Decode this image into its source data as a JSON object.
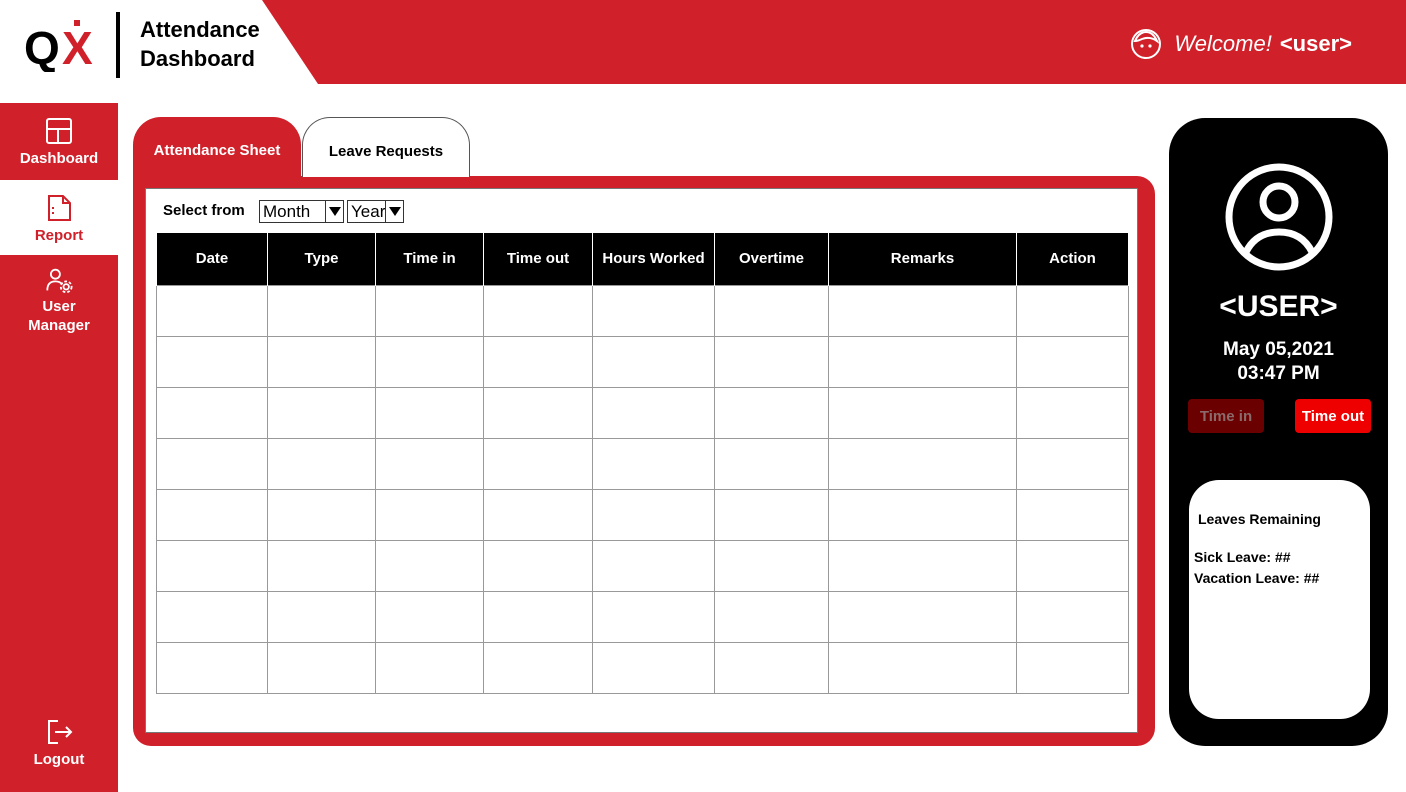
{
  "header": {
    "logo_text": "QX",
    "title_line1": "Attendance",
    "title_line2": "Dashboard",
    "welcome_text": "Welcome!",
    "username": "<user>"
  },
  "sidebar": {
    "items": [
      {
        "label": "Dashboard",
        "icon": "dashboard-icon",
        "active": false
      },
      {
        "label": "Report",
        "icon": "report-icon",
        "active": true
      },
      {
        "label_line1": "User",
        "label_line2": "Manager",
        "icon": "user-manager-icon",
        "active": false
      },
      {
        "label": "Logout",
        "icon": "logout-icon",
        "active": false
      }
    ]
  },
  "tabs": [
    {
      "label": "Attendance Sheet",
      "active": true
    },
    {
      "label": "Leave Requests",
      "active": false
    }
  ],
  "filters": {
    "label": "Select from",
    "month": "Month",
    "year": "Year"
  },
  "table": {
    "columns": [
      "Date",
      "Type",
      "Time in",
      "Time out",
      "Hours Worked",
      "Overtime",
      "Remarks",
      "Action"
    ],
    "row_count": 8
  },
  "user_card": {
    "username": "<USER>",
    "date": "May 05,2021",
    "time": "03:47 PM",
    "time_in_label": "Time in",
    "time_out_label": "Time out",
    "leaves_title": "Leaves Remaining",
    "sick_leave": "Sick Leave: ##",
    "vacation_leave": "Vacation Leave: ##"
  },
  "colors": {
    "brand_red": "#d0202a",
    "dark_red": "#6b0000",
    "bright_red": "#ee0000",
    "black": "#000000"
  }
}
